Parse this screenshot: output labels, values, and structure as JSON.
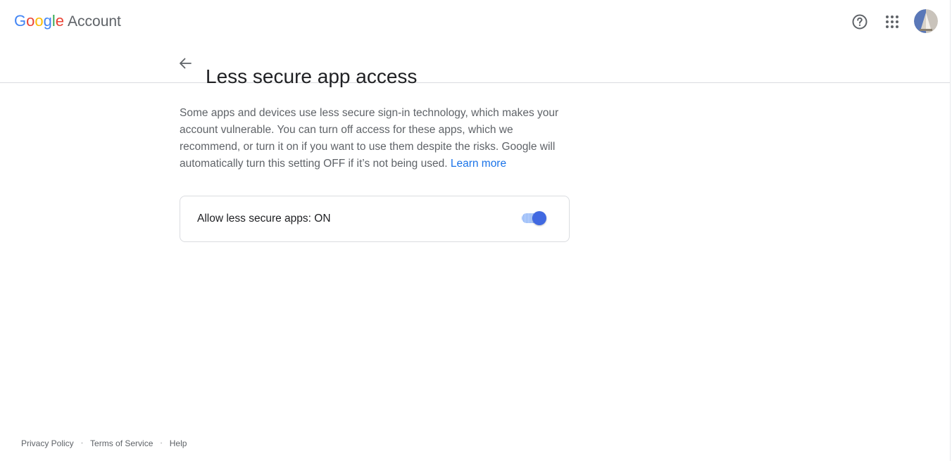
{
  "header": {
    "logo_letters": [
      {
        "ch": "G",
        "color": "#4285F4"
      },
      {
        "ch": "o",
        "color": "#EA4335"
      },
      {
        "ch": "o",
        "color": "#FBBC05"
      },
      {
        "ch": "g",
        "color": "#4285F4"
      },
      {
        "ch": "l",
        "color": "#34A853"
      },
      {
        "ch": "e",
        "color": "#EA4335"
      }
    ],
    "product_name": "Account",
    "help_icon": "help-circle-icon",
    "apps_icon": "apps-grid-icon",
    "avatar_icon": "user-avatar"
  },
  "page": {
    "back_icon": "arrow-back-icon",
    "title": "Less secure app access",
    "description": "Some apps and devices use less secure sign-in technology, which makes your account vulnerable. You can turn off access for these apps, which we recommend, or turn it on if you want to use them despite the risks. Google will automatically turn this setting OFF if it’s not being used.",
    "learn_more": "Learn more"
  },
  "setting": {
    "label": "Allow less secure apps: ON",
    "state": "on",
    "accent_color": "#4169E1"
  },
  "footer": {
    "links": [
      "Privacy Policy",
      "Terms of Service",
      "Help"
    ],
    "separator": "·"
  }
}
